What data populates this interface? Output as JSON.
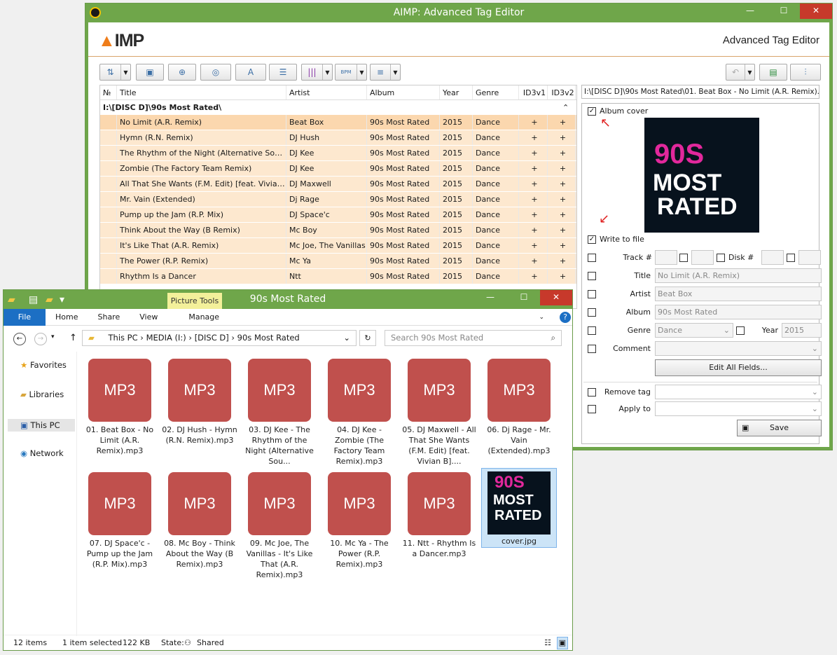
{
  "aimp": {
    "window_title": "AIMP: Advanced Tag Editor",
    "logo": "AIMP",
    "subtitle": "Advanced Tag Editor",
    "columns": [
      "№",
      "Title",
      "Artist",
      "Album",
      "Year",
      "Genre",
      "ID3v1",
      "ID3v2"
    ],
    "group": "I:\\[DISC D]\\90s Most Rated\\",
    "rows": [
      [
        "No Limit (A.R. Remix)",
        "Beat Box",
        "90s Most Rated",
        "2015",
        "Dance",
        "+",
        "+"
      ],
      [
        "Hymn (R.N. Remix)",
        "DJ Hush",
        "90s Most Rated",
        "2015",
        "Dance",
        "+",
        "+"
      ],
      [
        "The Rhythm of the Night (Alternative Sound...",
        "DJ Kee",
        "90s Most Rated",
        "2015",
        "Dance",
        "+",
        "+"
      ],
      [
        "Zombie (The Factory Team Remix)",
        "DJ Kee",
        "90s Most Rated",
        "2015",
        "Dance",
        "+",
        "+"
      ],
      [
        "All That She Wants (F.M. Edit) [feat. Vivian B]",
        "DJ Maxwell",
        "90s Most Rated",
        "2015",
        "Dance",
        "+",
        "+"
      ],
      [
        "Mr. Vain (Extended)",
        "Dj Rage",
        "90s Most Rated",
        "2015",
        "Dance",
        "+",
        "+"
      ],
      [
        "Pump up the Jam (R.P. Mix)",
        "DJ Space'c",
        "90s Most Rated",
        "2015",
        "Dance",
        "+",
        "+"
      ],
      [
        "Think About the Way (B Remix)",
        "Mc Boy",
        "90s Most Rated",
        "2015",
        "Dance",
        "+",
        "+"
      ],
      [
        "It's Like That (A.R. Remix)",
        "Mc Joe, The Vanillas",
        "90s Most Rated",
        "2015",
        "Dance",
        "+",
        "+"
      ],
      [
        "The Power (R.P. Remix)",
        "Mc Ya",
        "90s Most Rated",
        "2015",
        "Dance",
        "+",
        "+"
      ],
      [
        "Rhythm Is a Dancer",
        "Ntt",
        "90s Most Rated",
        "2015",
        "Dance",
        "+",
        "+"
      ]
    ],
    "path": "I:\\[DISC D]\\90s Most Rated\\01. Beat Box - No Limit (A.R. Remix).mp3",
    "album_cover_label": "Album cover",
    "cover_text_1": "90S",
    "cover_text_2": "MOST",
    "cover_text_3": "RATED",
    "write_to_file": "Write to file",
    "track_label": "Track #",
    "disk_label": "Disk #",
    "title_label": "Title",
    "title_value": "No Limit (A.R. Remix)",
    "artist_label": "Artist",
    "artist_value": "Beat Box",
    "album_label": "Album",
    "album_value": "90s Most Rated",
    "genre_label": "Genre",
    "genre_value": "Dance",
    "year_label": "Year",
    "year_value": "2015",
    "comment_label": "Comment",
    "edit_all": "Edit All Fields...",
    "remove_tag": "Remove tag",
    "apply_to": "Apply to",
    "save": "Save",
    "bpm": "BPM"
  },
  "explorer": {
    "title": "90s Most Rated",
    "picture_tools": "Picture Tools",
    "tabs": [
      "File",
      "Home",
      "Share",
      "View",
      "Manage"
    ],
    "breadcrumb": [
      "This PC",
      "MEDIA (I:)",
      "[DISC D]",
      "90s Most Rated"
    ],
    "search_placeholder": "Search 90s Most Rated",
    "nav": [
      "Favorites",
      "Libraries",
      "This PC",
      "Network"
    ],
    "mp3_label": "MP3",
    "files": [
      "01. Beat Box - No Limit (A.R. Remix).mp3",
      "02. DJ Hush - Hymn (R.N. Remix).mp3",
      "03. DJ Kee - The Rhythm of the Night (Alternative Sou...",
      "04. DJ Kee - Zombie (The Factory Team Remix).mp3",
      "05. DJ Maxwell - All That She Wants (F.M. Edit) [feat. Vivian B]....",
      "06. Dj Rage - Mr. Vain (Extended).mp3",
      "07. DJ Space'c - Pump up the Jam (R.P. Mix).mp3",
      "08. Mc Boy - Think About the Way (B Remix).mp3",
      "09. Mc Joe, The Vanillas - It's Like That (A.R. Remix).mp3",
      "10. Mc Ya - The Power (R.P. Remix).mp3",
      "11. Ntt - Rhythm Is a Dancer.mp3",
      "cover.jpg"
    ],
    "status_items": "12 items",
    "status_selected": "1 item selected",
    "status_size": "122 KB",
    "status_state": "State:",
    "status_shared": "Shared"
  }
}
